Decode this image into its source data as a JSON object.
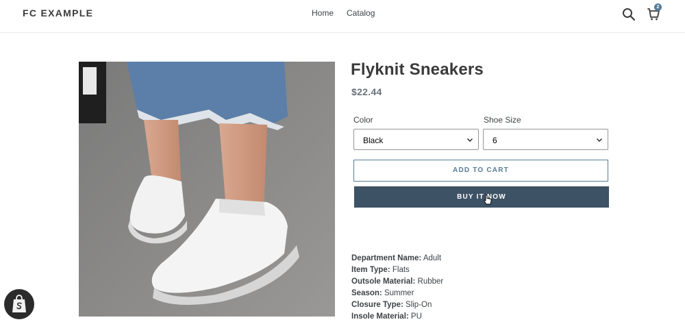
{
  "header": {
    "logo": "FC EXAMPLE",
    "nav": [
      "Home",
      "Catalog"
    ],
    "cart_count": "2",
    "search_icon": "search-icon",
    "cart_icon": "cart-icon"
  },
  "product": {
    "title": "Flyknit Sneakers",
    "price": "$22.44",
    "options": {
      "color": {
        "label": "Color",
        "value": "Black"
      },
      "size": {
        "label": "Shoe Size",
        "value": "6"
      }
    },
    "add_to_cart": "ADD TO CART",
    "buy_now": "BUY IT NOW",
    "specs": [
      {
        "key": "Department Name:",
        "value": "Adult"
      },
      {
        "key": "Item Type:",
        "value": "Flats"
      },
      {
        "key": "Outsole Material:",
        "value": "Rubber"
      },
      {
        "key": "Season:",
        "value": "Summer"
      },
      {
        "key": "Closure Type:",
        "value": "Slip-On"
      },
      {
        "key": "Insole Material:",
        "value": "PU"
      }
    ]
  },
  "colors": {
    "accent": "#557b97",
    "buy_button": "#3e5265",
    "price": "#69727b"
  }
}
